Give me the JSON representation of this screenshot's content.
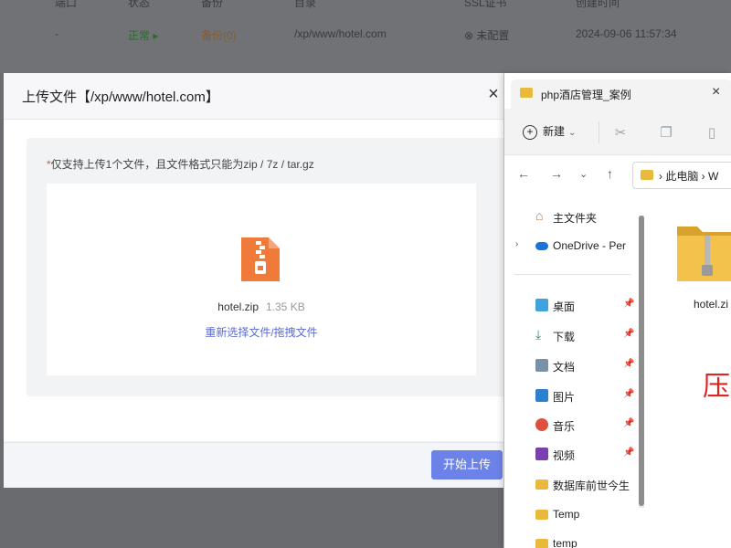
{
  "background": {
    "headers": [
      "端口",
      "状态",
      "备份",
      "目录",
      "SSL证书",
      "创建时间"
    ],
    "row": [
      "-",
      "正常",
      "备份(0)",
      "/xp/www/hotel.com",
      "未配置",
      "2024-09-06 11:57:34"
    ]
  },
  "dialog": {
    "title": "上传文件【/xp/www/hotel.com】",
    "close": "×",
    "notice_required": "*",
    "notice": "仅支持上传1个文件，且文件格式只能为zip / 7z / tar.gz",
    "file_name": "hotel.zip",
    "file_size": "1.35 KB",
    "reselect": "重新选择文件/拖拽文件",
    "start_button": "开始上传"
  },
  "explorer": {
    "tab_title": "php酒店管理_案例",
    "tab_close": "×",
    "new_button": "新建",
    "address": "此电脑 › W",
    "nav": [
      {
        "label": "主文件夹",
        "icon": "home-icon"
      },
      {
        "label": "OneDrive - Per",
        "icon": "cloud-icon"
      },
      {
        "label": "桌面",
        "icon": "desktop-icon"
      },
      {
        "label": "下载",
        "icon": "download-icon"
      },
      {
        "label": "文档",
        "icon": "document-icon"
      },
      {
        "label": "图片",
        "icon": "picture-icon"
      },
      {
        "label": "音乐",
        "icon": "music-icon"
      },
      {
        "label": "视频",
        "icon": "video-icon"
      },
      {
        "label": "数据库前世今生",
        "icon": "folder-icon"
      },
      {
        "label": "Temp",
        "icon": "folder-icon"
      },
      {
        "label": "temp",
        "icon": "folder-icon"
      }
    ],
    "content_file": "hotel.zi",
    "red_text": "压"
  },
  "colors": {
    "accent": "#6c82e8",
    "zip_orange": "#f07a3a",
    "folder_yellow": "#e8b93a",
    "red": "#e02424"
  }
}
